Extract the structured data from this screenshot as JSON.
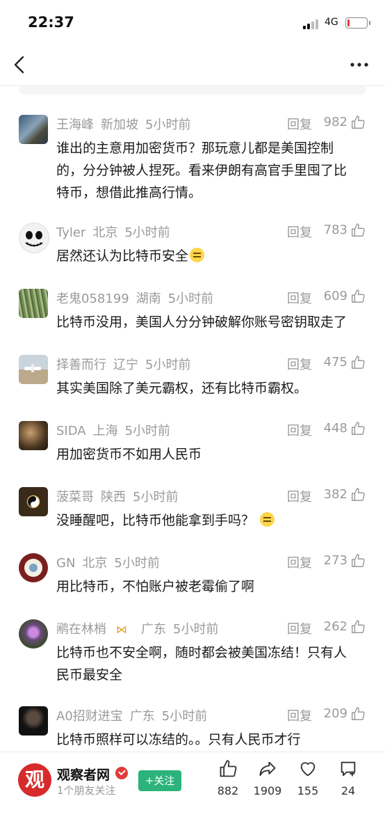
{
  "status_bar": {
    "time": "22:37",
    "network": "4G"
  },
  "comments": [
    {
      "user": "王海峰",
      "location": "新加坡",
      "time": "5小时前",
      "reply": "回复",
      "likes": "982",
      "lines": [
        "谁出的主意用加密货币？那玩意儿都是美国控制",
        "的，分分钟被人捏死。看来伊朗有高官手里囤了比",
        "特币，想借此推高行情。"
      ]
    },
    {
      "user": "Tyler",
      "location": "北京",
      "time": "5小时前",
      "reply": "回复",
      "likes": "783",
      "lines": [
        "居然还认为比特币安全"
      ]
    },
    {
      "user": "老鬼058199",
      "location": "湖南",
      "time": "5小时前",
      "reply": "回复",
      "likes": "609",
      "lines": [
        "比特币没用，美国人分分钟破解你账号密钥取走了"
      ]
    },
    {
      "user": "择善而行",
      "location": "辽宁",
      "time": "5小时前",
      "reply": "回复",
      "likes": "475",
      "lines": [
        "其实美国除了美元霸权，还有比特币霸权。"
      ]
    },
    {
      "user": "SIDA",
      "location": "上海",
      "time": "5小时前",
      "reply": "回复",
      "likes": "448",
      "lines": [
        "用加密货币不如用人民币"
      ]
    },
    {
      "user": "菠菜哥",
      "location": "陕西",
      "time": "5小时前",
      "reply": "回复",
      "likes": "382",
      "lines": [
        "没睡醒吧，比特币他能拿到手吗？"
      ]
    },
    {
      "user": "GN",
      "location": "北京",
      "time": "5小时前",
      "reply": "回复",
      "likes": "273",
      "lines": [
        "用比特币，不怕账户被老霉偷了啊"
      ]
    },
    {
      "user": "鹇在林梢",
      "location": "广东",
      "time": "5小时前",
      "reply": "回复",
      "likes": "262",
      "lines": [
        "比特币也不安全啊，随时都会被美国冻结！只有人",
        "民币最安全"
      ]
    },
    {
      "user": "A0招财进宝",
      "location": "广东",
      "time": "5小时前",
      "reply": "回复",
      "likes": "209",
      "lines": [
        "比特币照样可以冻结的。。只有人民币才行"
      ]
    }
  ],
  "footer": {
    "logo_char": "观",
    "brand": "观察者网",
    "friends": "1个朋友关注",
    "follow": "+关注",
    "likes": "882",
    "shares": "1909",
    "favorites": "155",
    "comments": "24"
  },
  "colors": {
    "accent_green": "#2bb37b",
    "brand_red": "#d72b2b",
    "meta_grey": "#9a9a9a"
  }
}
